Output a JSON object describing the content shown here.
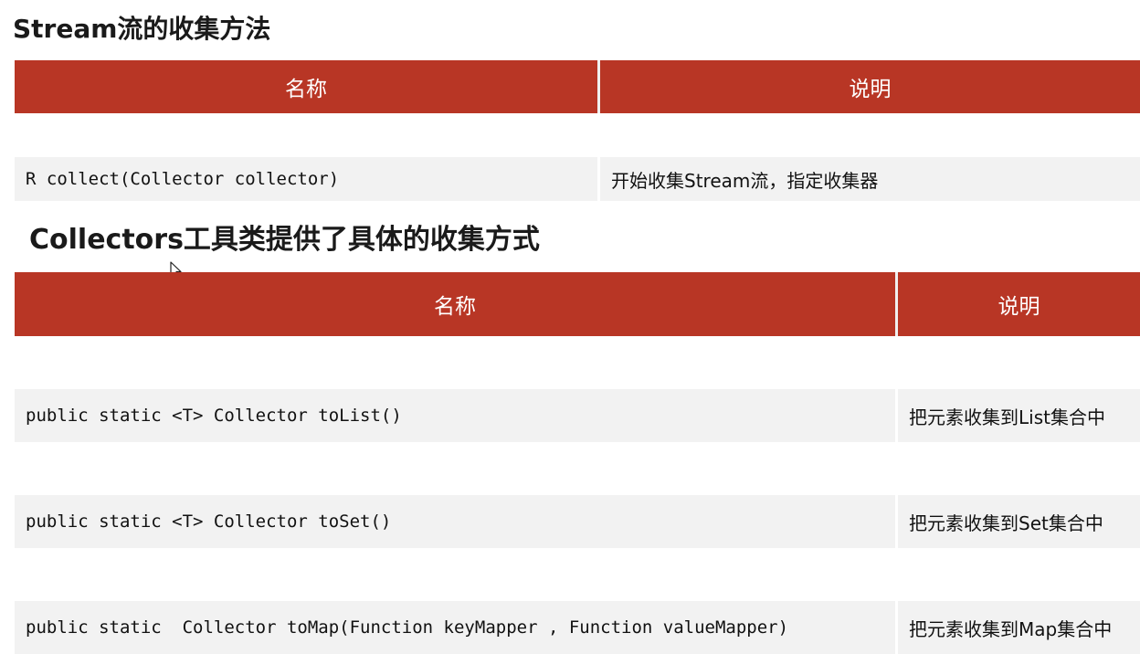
{
  "section1": {
    "title": "Stream流的收集方法",
    "headers": [
      "名称",
      "说明"
    ],
    "rows": [
      {
        "name": "R collect(Collector collector)",
        "desc": "开始收集Stream流，指定收集器"
      }
    ]
  },
  "section2": {
    "title": "Collectors工具类提供了具体的收集方式",
    "headers": [
      "名称",
      "说明"
    ],
    "rows": [
      {
        "name": "public static <T> Collector toList()",
        "desc": "把元素收集到List集合中"
      },
      {
        "name": "public static <T> Collector toSet()",
        "desc": "把元素收集到Set集合中"
      },
      {
        "name": "public static  Collector toMap(Function keyMapper , Function valueMapper)",
        "desc": "把元素收集到Map集合中"
      }
    ]
  },
  "colors": {
    "header_bg": "#b83625",
    "header_text": "#ffffff",
    "row_bg": "#f2f2f2"
  },
  "icons": {
    "cursor": "mouse-pointer-icon"
  }
}
